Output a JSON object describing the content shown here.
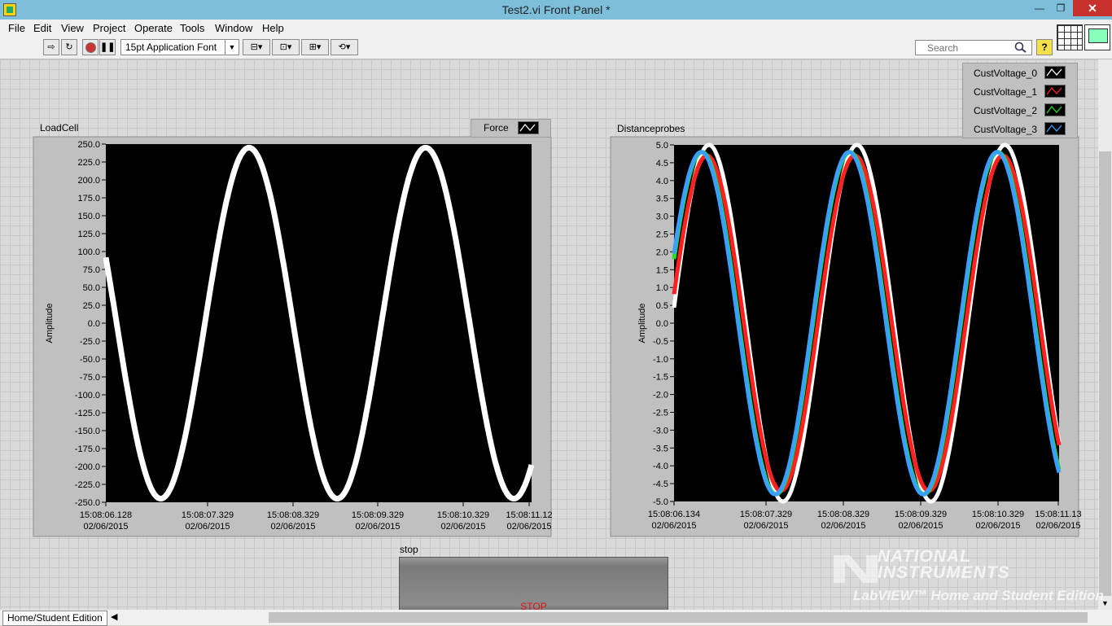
{
  "window": {
    "title": "Test2.vi Front Panel *",
    "minimize": "—",
    "maximize": "❐",
    "close": "✕"
  },
  "menu": [
    "File",
    "Edit",
    "View",
    "Project",
    "Operate",
    "Tools",
    "Window",
    "Help"
  ],
  "toolbar": {
    "run_icon": "run-arrow-icon",
    "run_continuous_icon": "run-continuously-icon",
    "abort_icon": "abort-icon",
    "pause_icon": "pause-icon",
    "font": "15pt Application Font",
    "align_icon": "align-objects-icon",
    "distribute_icon": "distribute-objects-icon",
    "resize_icon": "resize-objects-icon",
    "reorder_icon": "reorder-icon",
    "search_placeholder": "Search",
    "help": "?"
  },
  "charts": [
    {
      "label": "LoadCell",
      "legend": [
        {
          "name": "Force",
          "color": "#ffffff"
        }
      ],
      "ylabel": "Amplitude",
      "y_ticks": [
        "250.0",
        "225.0",
        "200.0",
        "175.0",
        "150.0",
        "125.0",
        "100.0",
        "75.0",
        "50.0",
        "25.0",
        "0.0",
        "-25.0",
        "-50.0",
        "-75.0",
        "-100.0",
        "-125.0",
        "-150.0",
        "-175.0",
        "-200.0",
        "-225.0",
        "-250.0"
      ],
      "x_ticks": [
        {
          "time": "15:08:06.128",
          "date": "02/06/2015"
        },
        {
          "time": "15:08:07.329",
          "date": "02/06/2015"
        },
        {
          "time": "15:08:08.329",
          "date": "02/06/2015"
        },
        {
          "time": "15:08:09.329",
          "date": "02/06/2015"
        },
        {
          "time": "15:08:10.329",
          "date": "02/06/2015"
        },
        {
          "time": "15:08:11.12",
          "date": "02/06/2015"
        }
      ]
    },
    {
      "label": "Distanceprobes",
      "legend": [
        {
          "name": "CustVoltage_0",
          "color": "#ffffff"
        },
        {
          "name": "CustVoltage_1",
          "color": "#ff2020"
        },
        {
          "name": "CustVoltage_2",
          "color": "#20e020"
        },
        {
          "name": "CustVoltage_3",
          "color": "#3aa0ff"
        }
      ],
      "ylabel": "Amplitude",
      "y_ticks": [
        "5.0",
        "4.5",
        "4.0",
        "3.5",
        "3.0",
        "2.5",
        "2.0",
        "1.5",
        "1.0",
        "0.5",
        "0.0",
        "-0.5",
        "-1.0",
        "-1.5",
        "-2.0",
        "-2.5",
        "-3.0",
        "-3.5",
        "-4.0",
        "-4.5",
        "-5.0"
      ],
      "x_ticks": [
        {
          "time": "15:08:06.134",
          "date": "02/06/2015"
        },
        {
          "time": "15:08:07.329",
          "date": "02/06/2015"
        },
        {
          "time": "15:08:08.329",
          "date": "02/06/2015"
        },
        {
          "time": "15:08:09.329",
          "date": "02/06/2015"
        },
        {
          "time": "15:08:10.329",
          "date": "02/06/2015"
        },
        {
          "time": "15:08:11.13",
          "date": "02/06/2015"
        }
      ]
    }
  ],
  "chart_data": [
    {
      "type": "line",
      "title": "LoadCell",
      "xlabel": "",
      "ylabel": "Amplitude",
      "ylim": [
        -250,
        250
      ],
      "x_range": [
        "15:08:06.128",
        "15:08:11.12"
      ],
      "grid": false,
      "legend": "top-right",
      "series": [
        {
          "name": "Force",
          "color": "#ffffff",
          "waveform": "sine",
          "amplitude": 245,
          "period_s": 2.07,
          "phase_deg": 158
        }
      ]
    },
    {
      "type": "line",
      "title": "Distanceprobes",
      "xlabel": "",
      "ylabel": "Amplitude",
      "ylim": [
        -5,
        5
      ],
      "x_range": [
        "15:08:06.134",
        "15:08:11.13"
      ],
      "grid": false,
      "legend": "top-right",
      "series": [
        {
          "name": "CustVoltage_0",
          "color": "#ffffff",
          "waveform": "sine",
          "amplitude": 5.0,
          "period_s": 1.92,
          "phase_deg": 5
        },
        {
          "name": "CustVoltage_1",
          "color": "#ff2020",
          "waveform": "sine",
          "amplitude": 4.7,
          "period_s": 1.92,
          "phase_deg": 10
        },
        {
          "name": "CustVoltage_2",
          "color": "#20e020",
          "waveform": "sine",
          "amplitude": 4.8,
          "period_s": 1.92,
          "phase_deg": 22
        },
        {
          "name": "CustVoltage_3",
          "color": "#3aa0ff",
          "waveform": "sine",
          "amplitude": 4.8,
          "period_s": 1.92,
          "phase_deg": 24
        }
      ]
    }
  ],
  "stop": {
    "label": "stop",
    "text": "STOP"
  },
  "status": {
    "context": "Home/Student Edition"
  },
  "watermark": {
    "line1": "NATIONAL",
    "line2": "INSTRUMENTS",
    "edition": "LabVIEW™ Home and Student Edition"
  }
}
